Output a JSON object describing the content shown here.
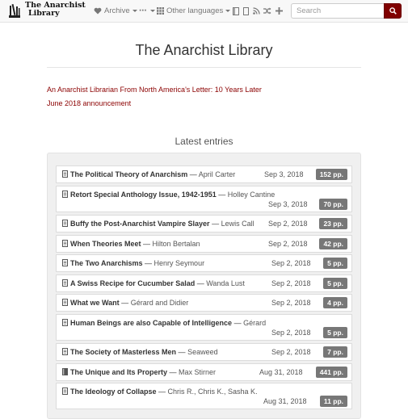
{
  "navbar": {
    "brand_line1": "The Anarchist",
    "brand_line2": "Library",
    "archive_label": "Archive",
    "more_label": "⋯",
    "languages_label": "Other languages",
    "search_placeholder": "Search",
    "icons": [
      "heart-icon",
      "ellipsis-icon",
      "grid-icon",
      "book-icon",
      "file-icon",
      "rss-icon",
      "shuffle-icon",
      "plus-icon",
      "search-icon"
    ]
  },
  "site_title": "The Anarchist Library",
  "announcements": [
    "An Anarchist Librarian From North America's Letter: 10 Years Later",
    "June 2018 announcement"
  ],
  "latest_heading": "Latest entries",
  "entries": [
    {
      "title": "The Political Theory of Anarchism",
      "author": "April Carter",
      "date": "Sep 3, 2018",
      "pages": "152 pp.",
      "icon": "file-icon"
    },
    {
      "title": "Retort Special Anthology Issue, 1942-1951",
      "author": "Holley Cantine",
      "date": "Sep 3, 2018",
      "pages": "70 pp.",
      "icon": "file-icon"
    },
    {
      "title": "Buffy the Post-Anarchist Vampire Slayer",
      "author": "Lewis Call",
      "date": "Sep 2, 2018",
      "pages": "23 pp.",
      "icon": "file-icon"
    },
    {
      "title": "When Theories Meet",
      "author": "Hilton Bertalan",
      "date": "Sep 2, 2018",
      "pages": "42 pp.",
      "icon": "file-icon"
    },
    {
      "title": "The Two Anarchisms",
      "author": "Henry Seymour",
      "date": "Sep 2, 2018",
      "pages": "5 pp.",
      "icon": "file-icon"
    },
    {
      "title": "A Swiss Recipe for Cucumber Salad",
      "author": "Wanda Lust",
      "date": "Sep 2, 2018",
      "pages": "5 pp.",
      "icon": "file-icon"
    },
    {
      "title": "What we Want",
      "author": "Gérard and Didier",
      "date": "Sep 2, 2018",
      "pages": "4 pp.",
      "icon": "file-icon"
    },
    {
      "title": "Human Beings are also Capable of Intelligence",
      "author": "Gérard",
      "date": "Sep 2, 2018",
      "pages": "5 pp.",
      "icon": "file-icon"
    },
    {
      "title": "The Society of Masterless Men",
      "author": "Seaweed",
      "date": "Sep 2, 2018",
      "pages": "7 pp.",
      "icon": "file-icon"
    },
    {
      "title": "The Unique and Its Property",
      "author": "Max Stirner",
      "date": "Aug 31, 2018",
      "pages": "441 pp.",
      "icon": "book-icon"
    },
    {
      "title": "The Ideology of Collapse",
      "author": "Chris R., Chris K., Sasha K.",
      "date": "Aug 31, 2018",
      "pages": "11 pp.",
      "icon": "file-icon"
    }
  ],
  "colors": {
    "accent": "#8b0000",
    "badge": "#777777",
    "navbar_bg": "#f8f8f8",
    "search_button": "#800000"
  }
}
